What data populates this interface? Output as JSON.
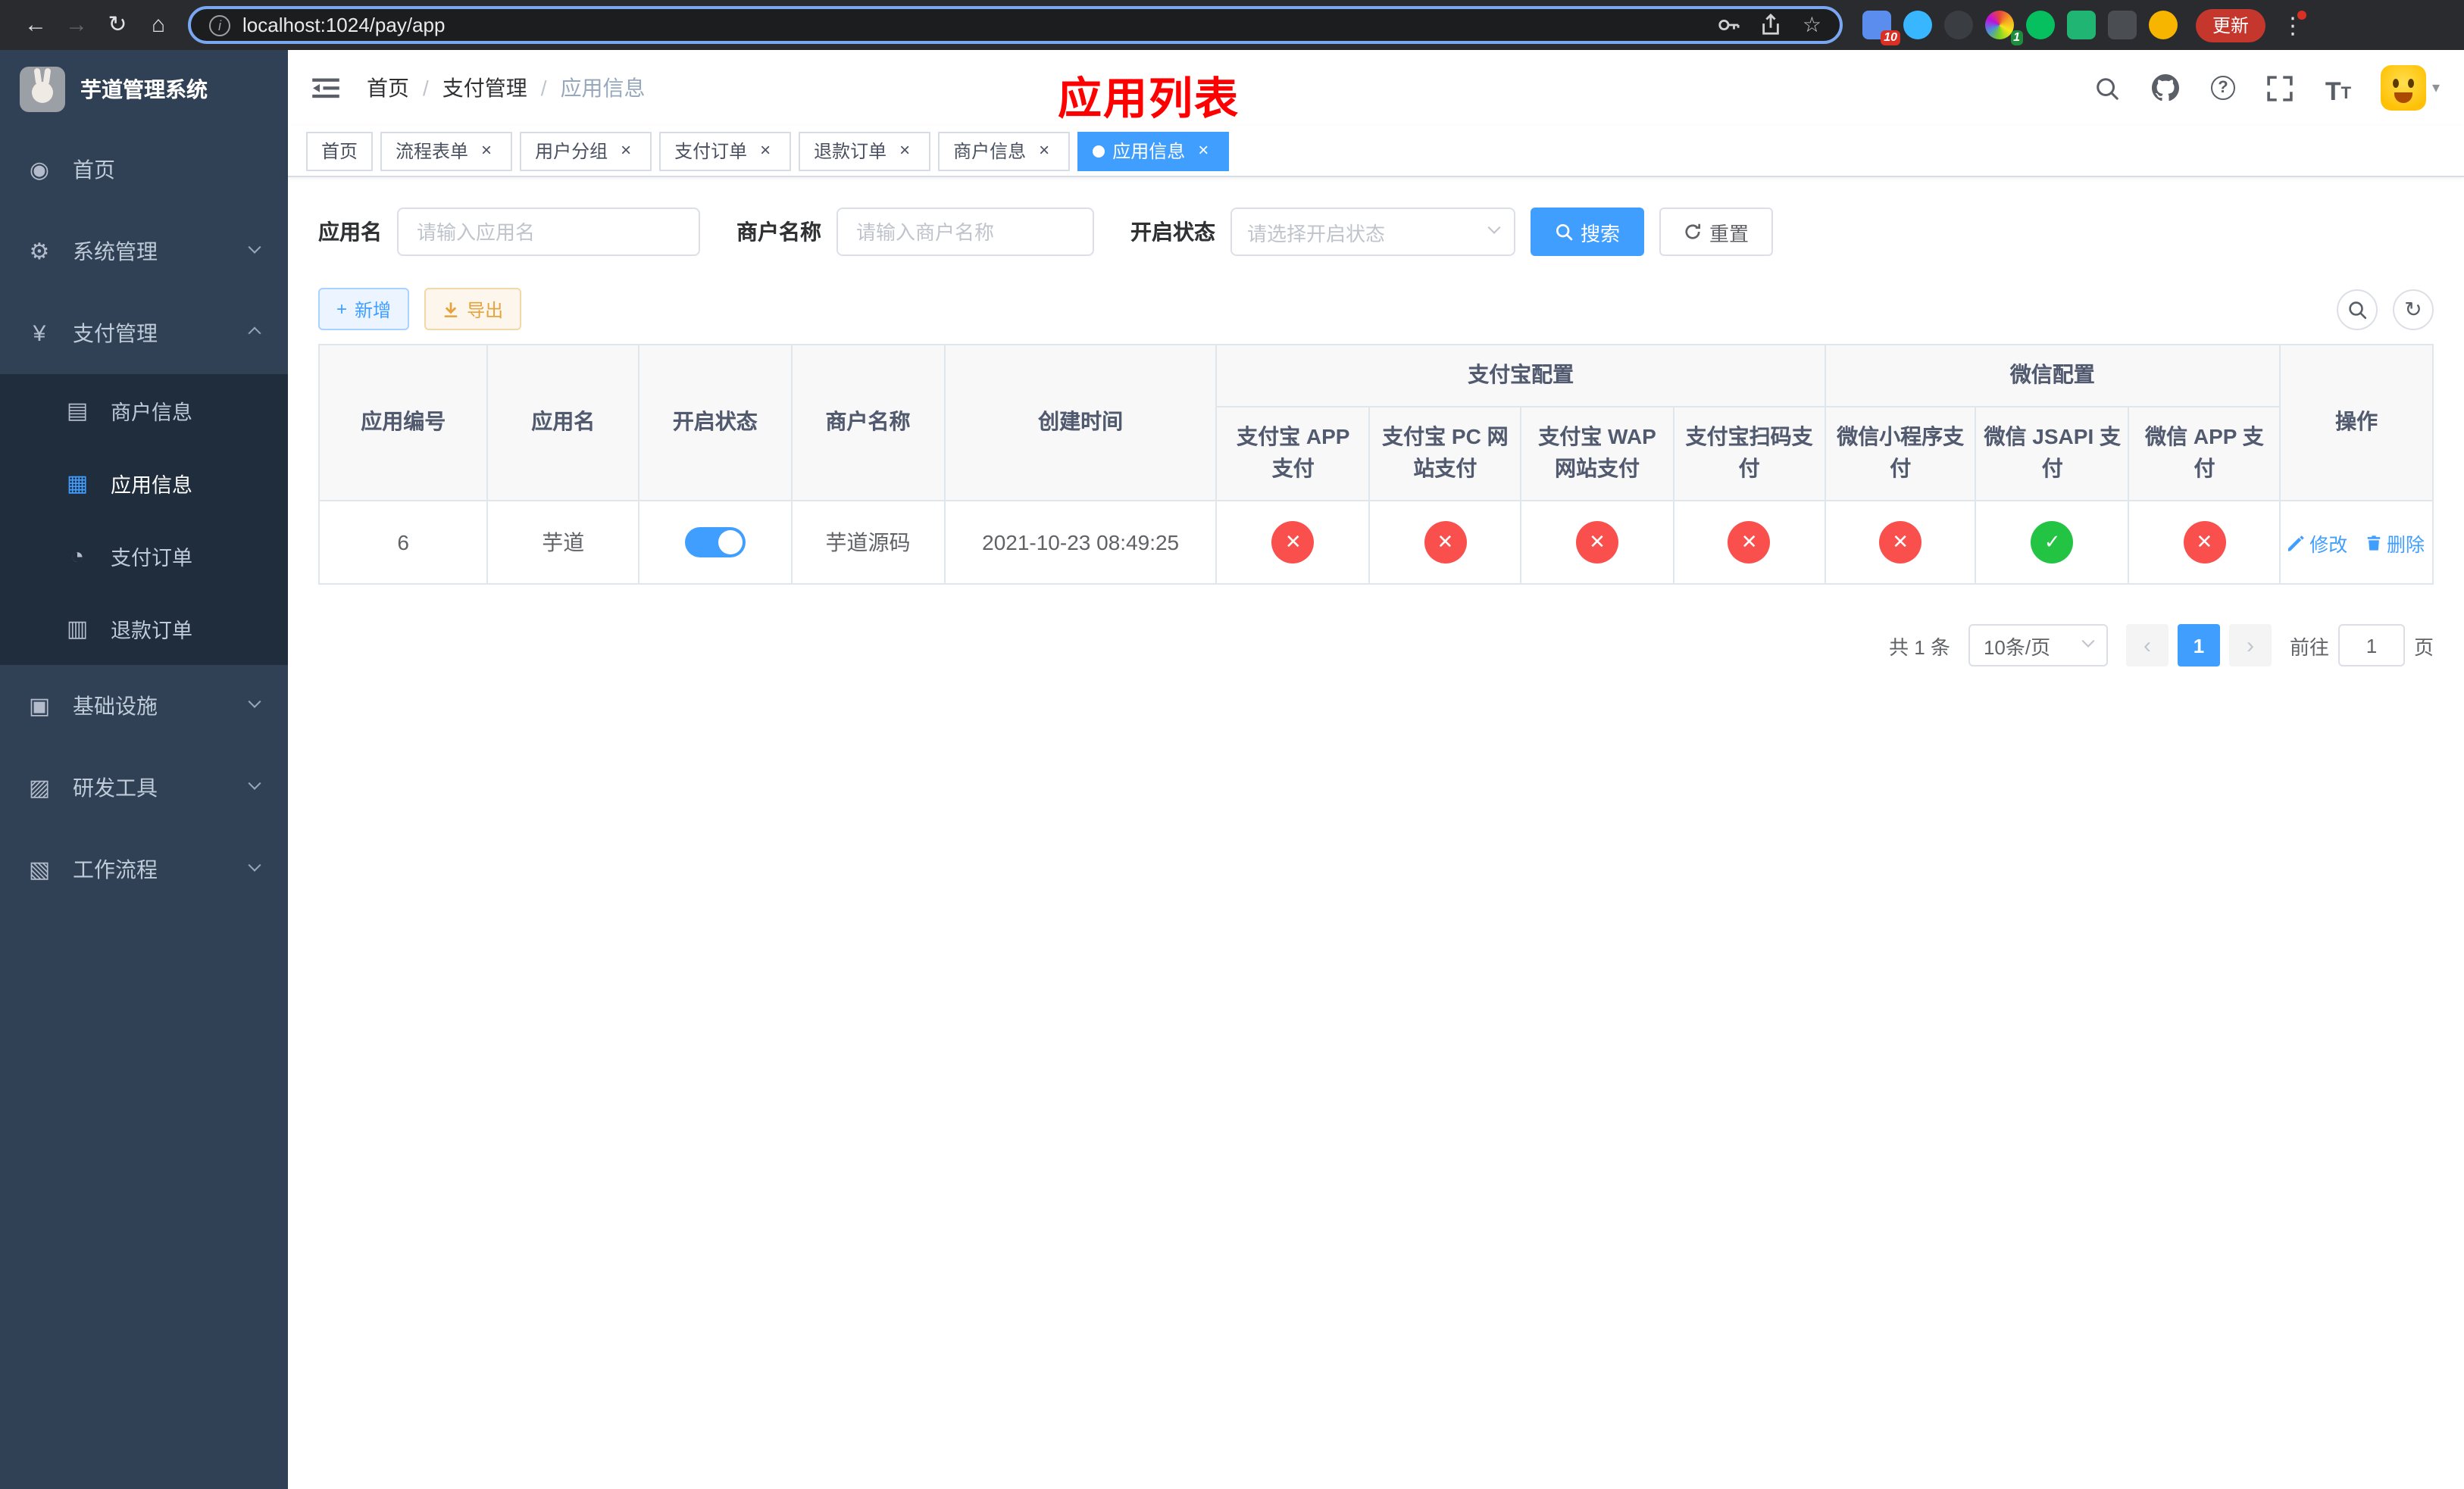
{
  "browser": {
    "url": "localhost:1024/pay/app",
    "update_label": "更新",
    "ext_badge_red": "10",
    "ext_badge_green": "1"
  },
  "sidebar": {
    "title": "芋道管理系统",
    "items": [
      {
        "label": "首页"
      },
      {
        "label": "系统管理"
      },
      {
        "label": "支付管理",
        "children": [
          {
            "label": "商户信息"
          },
          {
            "label": "应用信息"
          },
          {
            "label": "支付订单"
          },
          {
            "label": "退款订单"
          }
        ]
      },
      {
        "label": "基础设施"
      },
      {
        "label": "研发工具"
      },
      {
        "label": "工作流程"
      }
    ]
  },
  "header": {
    "breadcrumb": [
      "首页",
      "支付管理",
      "应用信息"
    ],
    "page_title": "应用列表"
  },
  "tabs": [
    {
      "label": "首页"
    },
    {
      "label": "流程表单"
    },
    {
      "label": "用户分组"
    },
    {
      "label": "支付订单"
    },
    {
      "label": "退款订单"
    },
    {
      "label": "商户信息"
    },
    {
      "label": "应用信息"
    }
  ],
  "filters": {
    "app_name_label": "应用名",
    "app_name_placeholder": "请输入应用名",
    "merchant_label": "商户名称",
    "merchant_placeholder": "请输入商户名称",
    "status_label": "开启状态",
    "status_placeholder": "请选择开启状态",
    "search_label": "搜索",
    "reset_label": "重置"
  },
  "toolbar": {
    "add_label": "新增",
    "export_label": "导出"
  },
  "table": {
    "groups": [
      "支付宝配置",
      "微信配置"
    ],
    "columns": [
      "应用编号",
      "应用名",
      "开启状态",
      "商户名称",
      "创建时间",
      "支付宝 APP 支付",
      "支付宝 PC 网站支付",
      "支付宝 WAP 网站支付",
      "支付宝扫码支付",
      "微信小程序支付",
      "微信 JSAPI 支付",
      "微信 APP 支付",
      "操作"
    ],
    "rows": [
      {
        "id": "6",
        "name": "芋道",
        "enabled": true,
        "merchant": "芋道源码",
        "created": "2021-10-23 08:49:25",
        "configs": {
          "alipay_app": false,
          "alipay_pc": false,
          "alipay_wap": false,
          "alipay_qr": false,
          "wechat_mini": false,
          "wechat_jsapi": true,
          "wechat_app": false
        },
        "edit_label": "修改",
        "delete_label": "删除"
      }
    ]
  },
  "pagination": {
    "total": "共 1 条",
    "page_size": "10条/页",
    "page": "1",
    "goto_label": "前往",
    "goto_value": "1",
    "goto_unit": "页"
  }
}
